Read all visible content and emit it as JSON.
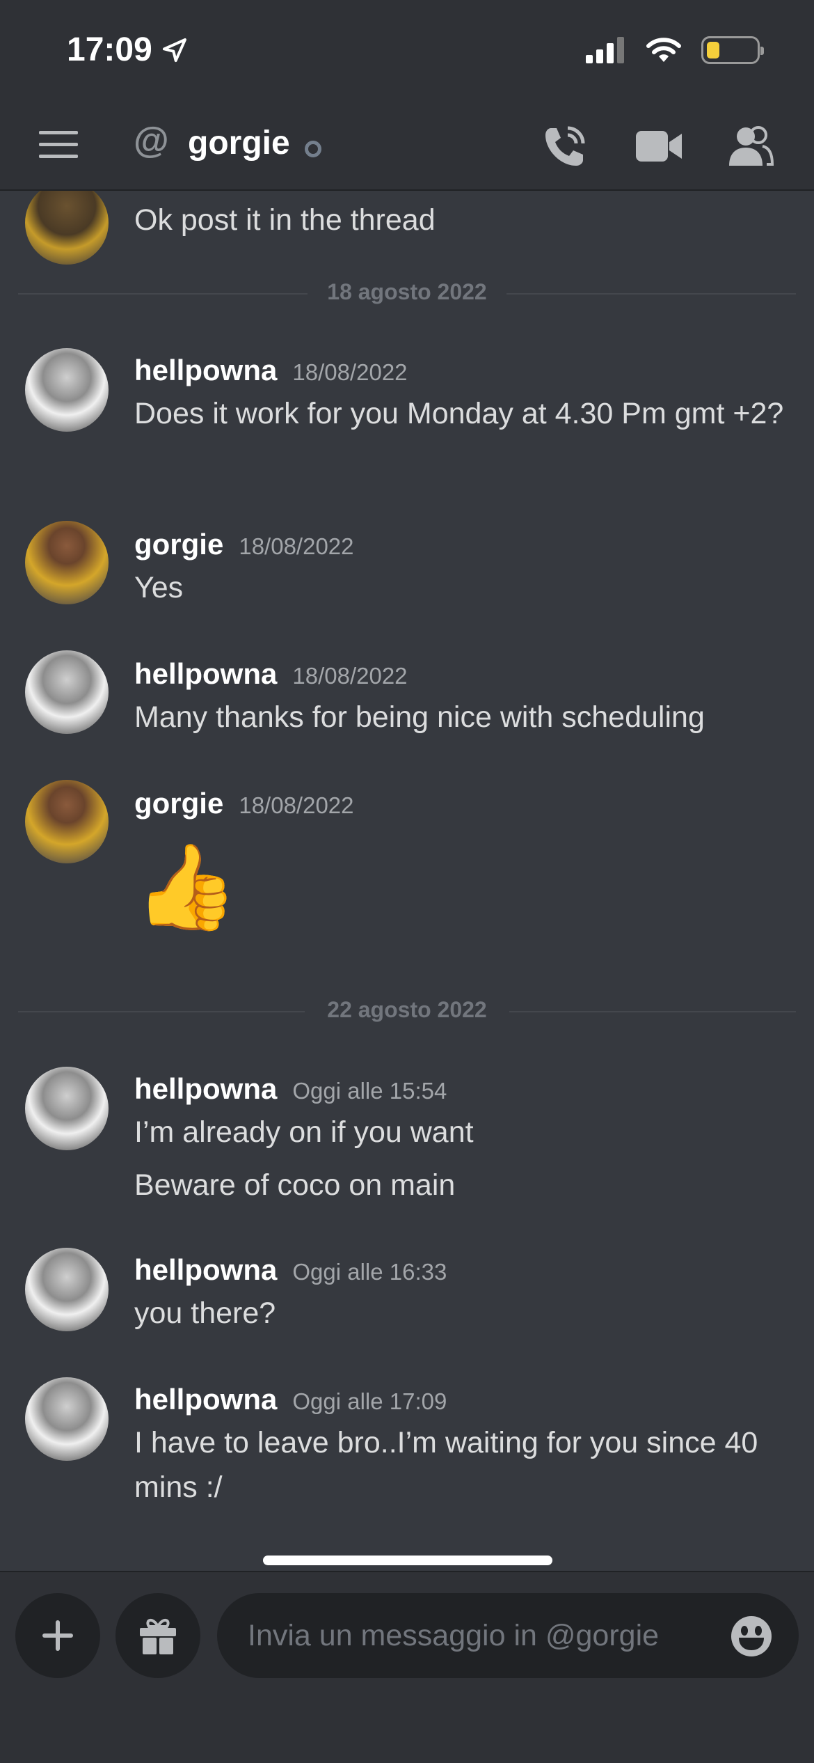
{
  "status_bar": {
    "time": "17:09"
  },
  "header": {
    "channel_prefix": "@",
    "channel_name": "gorgie"
  },
  "messages_partial": {
    "text": "Ok post it in the thread"
  },
  "dividers": [
    "18 agosto 2022",
    "22 agosto 2022"
  ],
  "messages": [
    {
      "author": "hellpowna",
      "time": "18/08/2022",
      "lines": [
        "Does it work for you Monday at 4.30 Pm gmt +2?"
      ]
    },
    {
      "author": "gorgie",
      "time": "18/08/2022",
      "lines": [
        "Yes"
      ]
    },
    {
      "author": "hellpowna",
      "time": "18/08/2022",
      "lines": [
        "Many thanks for being nice with scheduling"
      ]
    },
    {
      "author": "gorgie",
      "time": "18/08/2022",
      "lines": [
        "👍"
      ]
    },
    {
      "author": "hellpowna",
      "time": "Oggi alle 15:54",
      "lines": [
        "I’m already on if you want",
        "Beware of coco on main"
      ]
    },
    {
      "author": "hellpowna",
      "time": "Oggi alle 16:33",
      "lines": [
        "you there?"
      ]
    },
    {
      "author": "hellpowna",
      "time": "Oggi alle 17:09",
      "lines": [
        "I have to leave bro..I’m waiting for you since 40 mins :/"
      ]
    }
  ],
  "composer": {
    "placeholder": "Invia un messaggio in @gorgie"
  },
  "colors": {
    "background": "#36393f",
    "header": "#2f3136",
    "input": "#202225",
    "muted": "#72767d"
  }
}
